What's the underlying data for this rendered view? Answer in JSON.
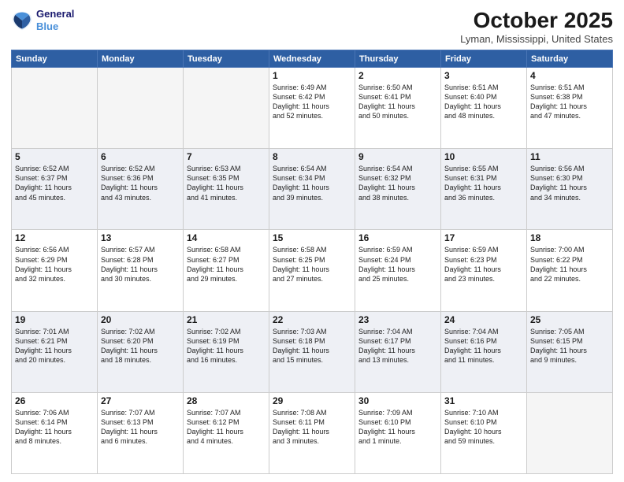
{
  "header": {
    "logo_line1": "General",
    "logo_line2": "Blue",
    "month": "October 2025",
    "location": "Lyman, Mississippi, United States"
  },
  "weekdays": [
    "Sunday",
    "Monday",
    "Tuesday",
    "Wednesday",
    "Thursday",
    "Friday",
    "Saturday"
  ],
  "weeks": [
    [
      {
        "day": "",
        "text": ""
      },
      {
        "day": "",
        "text": ""
      },
      {
        "day": "",
        "text": ""
      },
      {
        "day": "1",
        "text": "Sunrise: 6:49 AM\nSunset: 6:42 PM\nDaylight: 11 hours\nand 52 minutes."
      },
      {
        "day": "2",
        "text": "Sunrise: 6:50 AM\nSunset: 6:41 PM\nDaylight: 11 hours\nand 50 minutes."
      },
      {
        "day": "3",
        "text": "Sunrise: 6:51 AM\nSunset: 6:40 PM\nDaylight: 11 hours\nand 48 minutes."
      },
      {
        "day": "4",
        "text": "Sunrise: 6:51 AM\nSunset: 6:38 PM\nDaylight: 11 hours\nand 47 minutes."
      }
    ],
    [
      {
        "day": "5",
        "text": "Sunrise: 6:52 AM\nSunset: 6:37 PM\nDaylight: 11 hours\nand 45 minutes."
      },
      {
        "day": "6",
        "text": "Sunrise: 6:52 AM\nSunset: 6:36 PM\nDaylight: 11 hours\nand 43 minutes."
      },
      {
        "day": "7",
        "text": "Sunrise: 6:53 AM\nSunset: 6:35 PM\nDaylight: 11 hours\nand 41 minutes."
      },
      {
        "day": "8",
        "text": "Sunrise: 6:54 AM\nSunset: 6:34 PM\nDaylight: 11 hours\nand 39 minutes."
      },
      {
        "day": "9",
        "text": "Sunrise: 6:54 AM\nSunset: 6:32 PM\nDaylight: 11 hours\nand 38 minutes."
      },
      {
        "day": "10",
        "text": "Sunrise: 6:55 AM\nSunset: 6:31 PM\nDaylight: 11 hours\nand 36 minutes."
      },
      {
        "day": "11",
        "text": "Sunrise: 6:56 AM\nSunset: 6:30 PM\nDaylight: 11 hours\nand 34 minutes."
      }
    ],
    [
      {
        "day": "12",
        "text": "Sunrise: 6:56 AM\nSunset: 6:29 PM\nDaylight: 11 hours\nand 32 minutes."
      },
      {
        "day": "13",
        "text": "Sunrise: 6:57 AM\nSunset: 6:28 PM\nDaylight: 11 hours\nand 30 minutes."
      },
      {
        "day": "14",
        "text": "Sunrise: 6:58 AM\nSunset: 6:27 PM\nDaylight: 11 hours\nand 29 minutes."
      },
      {
        "day": "15",
        "text": "Sunrise: 6:58 AM\nSunset: 6:25 PM\nDaylight: 11 hours\nand 27 minutes."
      },
      {
        "day": "16",
        "text": "Sunrise: 6:59 AM\nSunset: 6:24 PM\nDaylight: 11 hours\nand 25 minutes."
      },
      {
        "day": "17",
        "text": "Sunrise: 6:59 AM\nSunset: 6:23 PM\nDaylight: 11 hours\nand 23 minutes."
      },
      {
        "day": "18",
        "text": "Sunrise: 7:00 AM\nSunset: 6:22 PM\nDaylight: 11 hours\nand 22 minutes."
      }
    ],
    [
      {
        "day": "19",
        "text": "Sunrise: 7:01 AM\nSunset: 6:21 PM\nDaylight: 11 hours\nand 20 minutes."
      },
      {
        "day": "20",
        "text": "Sunrise: 7:02 AM\nSunset: 6:20 PM\nDaylight: 11 hours\nand 18 minutes."
      },
      {
        "day": "21",
        "text": "Sunrise: 7:02 AM\nSunset: 6:19 PM\nDaylight: 11 hours\nand 16 minutes."
      },
      {
        "day": "22",
        "text": "Sunrise: 7:03 AM\nSunset: 6:18 PM\nDaylight: 11 hours\nand 15 minutes."
      },
      {
        "day": "23",
        "text": "Sunrise: 7:04 AM\nSunset: 6:17 PM\nDaylight: 11 hours\nand 13 minutes."
      },
      {
        "day": "24",
        "text": "Sunrise: 7:04 AM\nSunset: 6:16 PM\nDaylight: 11 hours\nand 11 minutes."
      },
      {
        "day": "25",
        "text": "Sunrise: 7:05 AM\nSunset: 6:15 PM\nDaylight: 11 hours\nand 9 minutes."
      }
    ],
    [
      {
        "day": "26",
        "text": "Sunrise: 7:06 AM\nSunset: 6:14 PM\nDaylight: 11 hours\nand 8 minutes."
      },
      {
        "day": "27",
        "text": "Sunrise: 7:07 AM\nSunset: 6:13 PM\nDaylight: 11 hours\nand 6 minutes."
      },
      {
        "day": "28",
        "text": "Sunrise: 7:07 AM\nSunset: 6:12 PM\nDaylight: 11 hours\nand 4 minutes."
      },
      {
        "day": "29",
        "text": "Sunrise: 7:08 AM\nSunset: 6:11 PM\nDaylight: 11 hours\nand 3 minutes."
      },
      {
        "day": "30",
        "text": "Sunrise: 7:09 AM\nSunset: 6:10 PM\nDaylight: 11 hours\nand 1 minute."
      },
      {
        "day": "31",
        "text": "Sunrise: 7:10 AM\nSunset: 6:10 PM\nDaylight: 10 hours\nand 59 minutes."
      },
      {
        "day": "",
        "text": ""
      }
    ]
  ]
}
